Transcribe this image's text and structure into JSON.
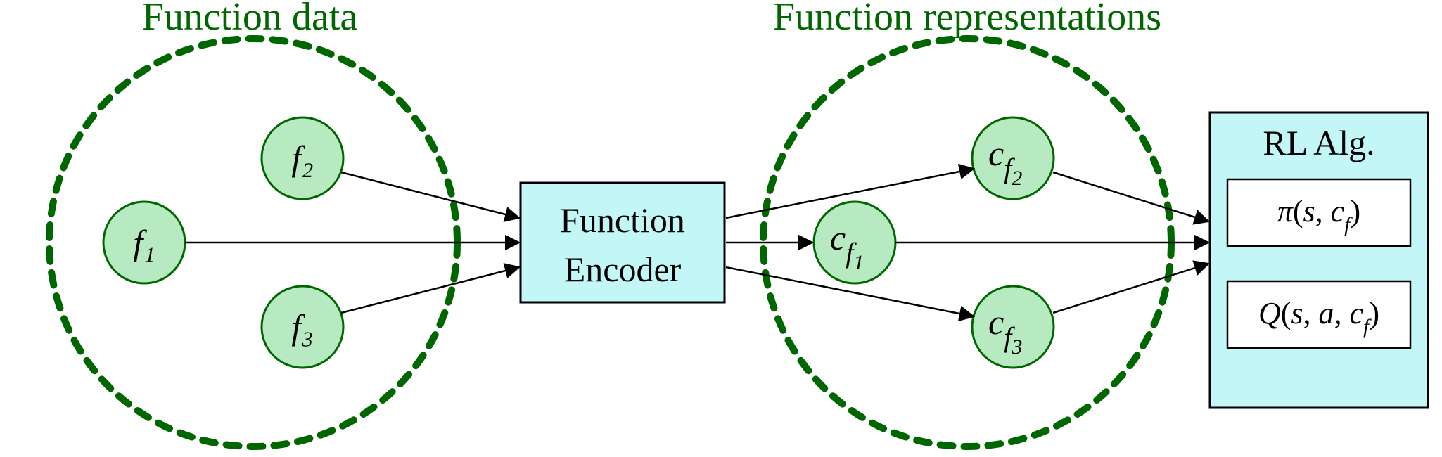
{
  "titles": {
    "left": "Function data",
    "right": "Function representations"
  },
  "encoder": {
    "line1": "Function",
    "line2": "Encoder"
  },
  "nodes": {
    "f1": "f₁",
    "f2": "f₂",
    "f3": "f₃",
    "c1_c": "c",
    "c1_f": "f",
    "c1_n": "1",
    "c2_c": "c",
    "c2_f": "f",
    "c2_n": "2",
    "c3_c": "c",
    "c3_f": "f",
    "c3_n": "3"
  },
  "rl": {
    "title": "RL Alg.",
    "pi_pi": "π",
    "pi_open": "(",
    "pi_s": "s",
    "pi_comma": ", ",
    "pi_c": "c",
    "pi_f": "f",
    "pi_close": ")",
    "q_Q": "Q",
    "q_open": "(",
    "q_s": "s",
    "q_c1": ", ",
    "q_a": "a",
    "q_c2": ", ",
    "q_c": "c",
    "q_f": "f",
    "q_close": ")"
  },
  "colors": {
    "green_dark": "#006600",
    "green_light": "#b7eac1",
    "cyan_light": "#c3f6f6",
    "black": "#000000"
  }
}
